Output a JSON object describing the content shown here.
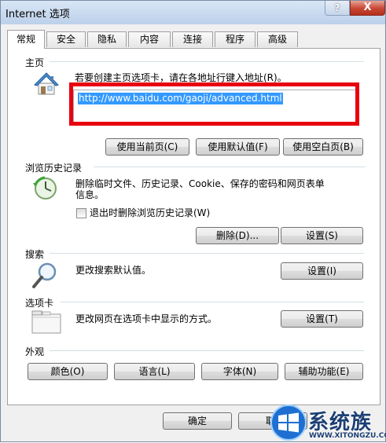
{
  "window": {
    "title": "Internet 选项",
    "help_label": "?",
    "close_label": "X"
  },
  "tabs": [
    {
      "label": "常规",
      "active": true
    },
    {
      "label": "安全"
    },
    {
      "label": "隐私"
    },
    {
      "label": "内容"
    },
    {
      "label": "连接"
    },
    {
      "label": "程序"
    },
    {
      "label": "高级"
    }
  ],
  "homepage": {
    "title": "主页",
    "description": "若要创建主页选项卡，请在各地址行键入地址(R)。",
    "url": "http://www.baidu.com/gaoji/advanced.html",
    "buttons": [
      "使用当前页(C)",
      "使用默认值(F)",
      "使用空白页(B)"
    ]
  },
  "history": {
    "title": "浏览历史记录",
    "description_line1": "删除临时文件、历史记录、Cookie、保存的密码和网页表单",
    "description_line2": "信息。",
    "checkbox_label": "退出时删除浏览历史记录(W)",
    "checkbox_checked": false,
    "delete_button": "删除(D)...",
    "settings_button": "设置(S)"
  },
  "search": {
    "title": "搜索",
    "description": "更改搜索默认值。",
    "settings_button": "设置(I)"
  },
  "tabs_section": {
    "title": "选项卡",
    "description": "更改网页在选项卡中显示的方式。",
    "settings_button": "设置(T)"
  },
  "appearance": {
    "title": "外观",
    "buttons": [
      "颜色(O)",
      "语言(L)",
      "字体(N)",
      "辅助功能(E)"
    ]
  },
  "footer": {
    "ok_button": "确定",
    "cancel_button": "取"
  },
  "watermark": {
    "brand": "系统族",
    "url": "WWW.XITONGZU.COM"
  },
  "colors": {
    "highlight_box": "#e8000f",
    "selection": "#3399ff"
  }
}
